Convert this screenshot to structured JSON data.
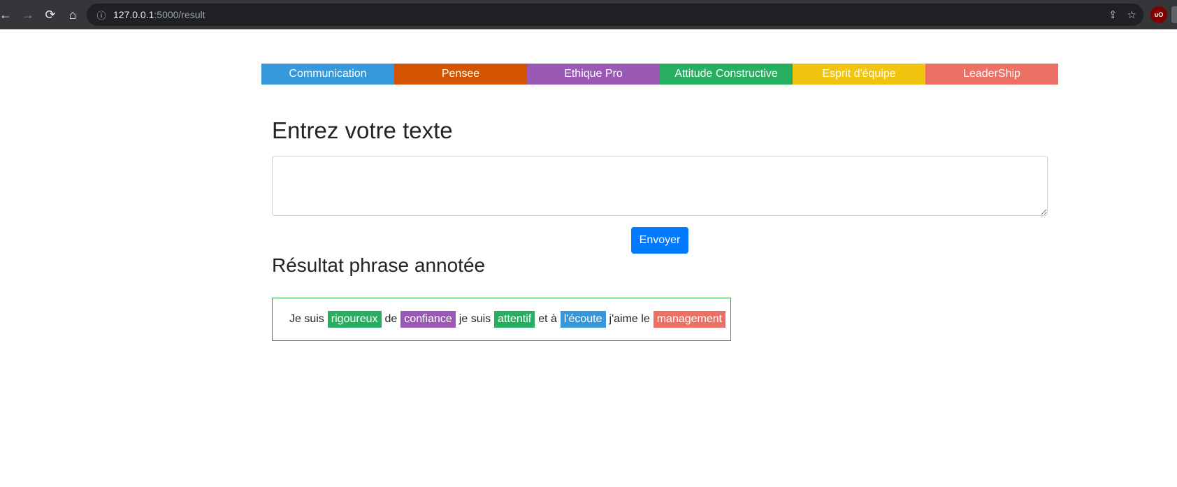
{
  "browser": {
    "url_host": "127.0.0.1",
    "url_path": ":5000/result"
  },
  "categories": [
    {
      "label": "Communication",
      "color": "#3498db"
    },
    {
      "label": "Pensee",
      "color": "#d35400"
    },
    {
      "label": "Ethique Pro",
      "color": "#9b59b6"
    },
    {
      "label": "Attitude Constructive",
      "color": "#27ae60"
    },
    {
      "label": "Esprit d'équipe",
      "color": "#f1c40f"
    },
    {
      "label": "LeaderShip",
      "color": "#ec7063"
    }
  ],
  "form": {
    "title": "Entrez votre texte",
    "textarea_value": "",
    "submit_label": "Envoyer"
  },
  "result": {
    "title": "Résultat phrase annotée",
    "tokens": [
      {
        "text": "Je suis",
        "color": null
      },
      {
        "text": "rigoureux",
        "color": "#27ae60"
      },
      {
        "text": "de",
        "color": null
      },
      {
        "text": "confiance",
        "color": "#9b59b6"
      },
      {
        "text": "je suis",
        "color": null
      },
      {
        "text": "attentif",
        "color": "#27ae60"
      },
      {
        "text": "et à",
        "color": null
      },
      {
        "text": "l'écoute",
        "color": "#3498db"
      },
      {
        "text": "j'aime le",
        "color": null
      },
      {
        "text": "management",
        "color": "#ec7063"
      }
    ]
  }
}
